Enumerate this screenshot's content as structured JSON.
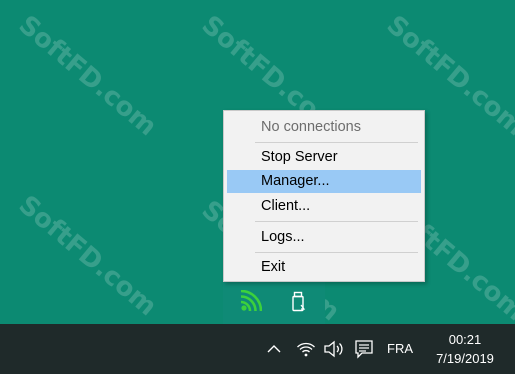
{
  "watermark": {
    "text": "SoftFD.com"
  },
  "menu": {
    "items": [
      {
        "label": "No connections",
        "state": "disabled"
      },
      {
        "label": "Stop Server",
        "state": "normal"
      },
      {
        "label": "Manager...",
        "state": "selected"
      },
      {
        "label": "Client...",
        "state": "normal"
      },
      {
        "label": "Logs...",
        "state": "normal"
      },
      {
        "label": "Exit",
        "state": "normal"
      }
    ]
  },
  "tray": {
    "icons": [
      "server-signal-icon",
      "usb-drive-icon"
    ]
  },
  "taskbar": {
    "icons": [
      "chevron-up-icon",
      "network-icon",
      "volume-icon",
      "action-center-icon"
    ],
    "language": "FRA",
    "time": "00:21",
    "date": "7/19/2019"
  },
  "colors": {
    "desktop": "#0c8a72",
    "menu_bg": "#f2f2f2",
    "menu_selected": "#99c9f5",
    "taskbar": "#1f2a2a",
    "server_icon": "#3cd13c"
  }
}
